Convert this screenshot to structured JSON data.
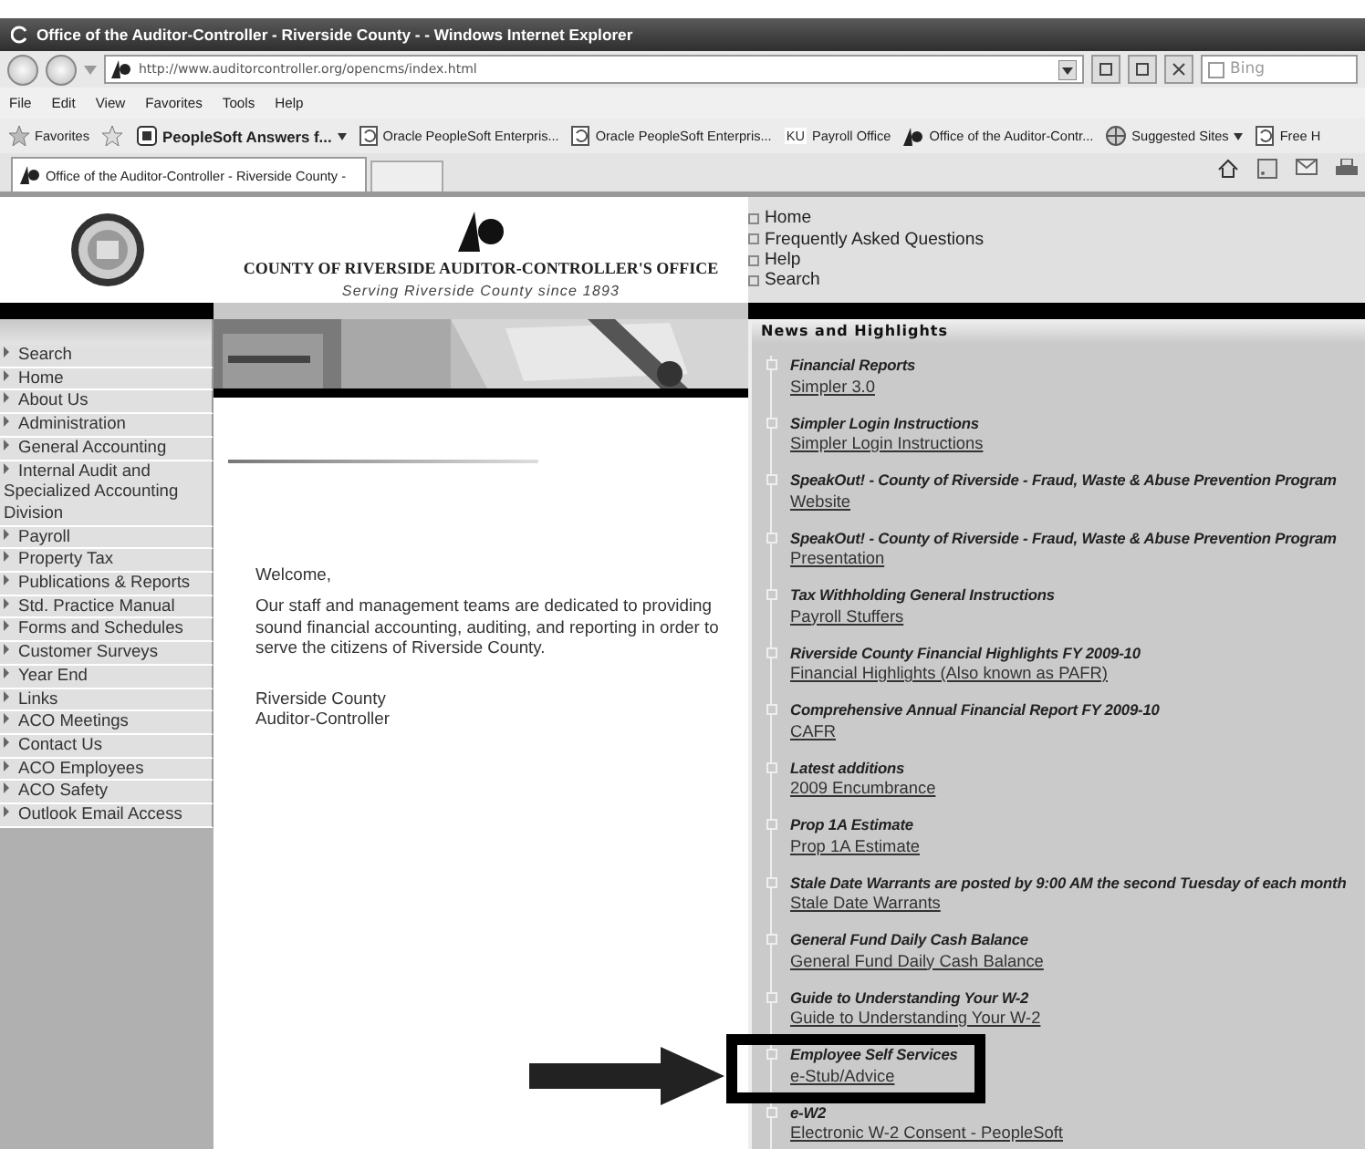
{
  "window": {
    "title": "Office of the Auditor-Controller - Riverside County - - Windows Internet Explorer"
  },
  "address_bar": {
    "url": "http://www.auditorcontroller.org/opencms/index.html"
  },
  "search_box": {
    "placeholder": "Bing"
  },
  "menu": [
    "File",
    "Edit",
    "View",
    "Favorites",
    "Tools",
    "Help"
  ],
  "favorites_bar": {
    "label": "Favorites",
    "items": [
      {
        "label": "PeopleSoft Answers f...",
        "kind": "feed"
      },
      {
        "label": "Oracle  PeopleSoft Enterpris...",
        "kind": "page"
      },
      {
        "label": "Oracle  PeopleSoft Enterpris...",
        "kind": "page"
      },
      {
        "label": "Payroll Office",
        "kind": "badge",
        "badge": "KU"
      },
      {
        "label": "Office of the Auditor-Contr...",
        "kind": "logo"
      },
      {
        "label": "Suggested Sites",
        "kind": "globe"
      },
      {
        "label": "Free H",
        "kind": "page"
      }
    ]
  },
  "tabs": [
    {
      "label": "Office of the Auditor-Controller - Riverside County -",
      "selected": true
    }
  ],
  "header": {
    "org_name": "COUNTY OF RIVERSIDE AUDITOR-CONTROLLER'S OFFICE",
    "tagline": "Serving Riverside County since 1893",
    "top_links": [
      "Home",
      "Frequently Asked Questions",
      "Help",
      "Search"
    ]
  },
  "sidebar": {
    "items": [
      "Search",
      "Home",
      "About Us",
      "Administration",
      "General Accounting",
      "Internal Audit and Specialized Accounting Division",
      "Payroll",
      "Property Tax",
      "Publications & Reports",
      "Std. Practice Manual",
      "Forms and Schedules",
      "Customer Surveys",
      "Year End",
      "Links",
      "ACO Meetings",
      "Contact Us",
      "ACO Employees",
      "ACO Safety",
      "Outlook Email Access"
    ]
  },
  "content": {
    "greeting": "Welcome,",
    "message": "Our staff and management teams are dedicated to providing sound financial accounting, auditing, and reporting in order to serve the citizens of Riverside County.",
    "signature": [
      "Riverside County",
      "Auditor-Controller"
    ]
  },
  "news": {
    "heading": "News and Highlights",
    "items": [
      {
        "title": "Financial Reports",
        "link": "Simpler 3.0"
      },
      {
        "title": "Simpler Login Instructions",
        "link": "Simpler Login Instructions"
      },
      {
        "title": "SpeakOut! - County of Riverside - Fraud, Waste & Abuse Prevention Program",
        "link": "Website"
      },
      {
        "title": "SpeakOut! - County of Riverside - Fraud, Waste & Abuse Prevention Program",
        "link": "Presentation"
      },
      {
        "title": "Tax Withholding General Instructions",
        "link": "Payroll Stuffers"
      },
      {
        "title": "Riverside County Financial Highlights FY 2009-10",
        "link": "Financial Highlights (Also known as PAFR)"
      },
      {
        "title": "Comprehensive Annual Financial Report FY 2009-10",
        "link": "CAFR"
      },
      {
        "title": "Latest additions",
        "link": "2009 Encumbrance"
      },
      {
        "title": "Prop 1A Estimate",
        "link": "Prop 1A Estimate"
      },
      {
        "title": "Stale Date Warrants are posted by 9:00 AM the second Tuesday of each month",
        "link": "Stale Date Warrants"
      },
      {
        "title": "General Fund Daily Cash Balance",
        "link": "General Fund Daily Cash Balance"
      },
      {
        "title": "Guide to Understanding Your W-2",
        "link": "Guide to Understanding Your W-2"
      },
      {
        "title": "Employee Self Services",
        "link": "e-Stub/Advice"
      },
      {
        "title": "e-W2",
        "link": "Electronic W-2 Consent - PeopleSoft"
      }
    ]
  }
}
